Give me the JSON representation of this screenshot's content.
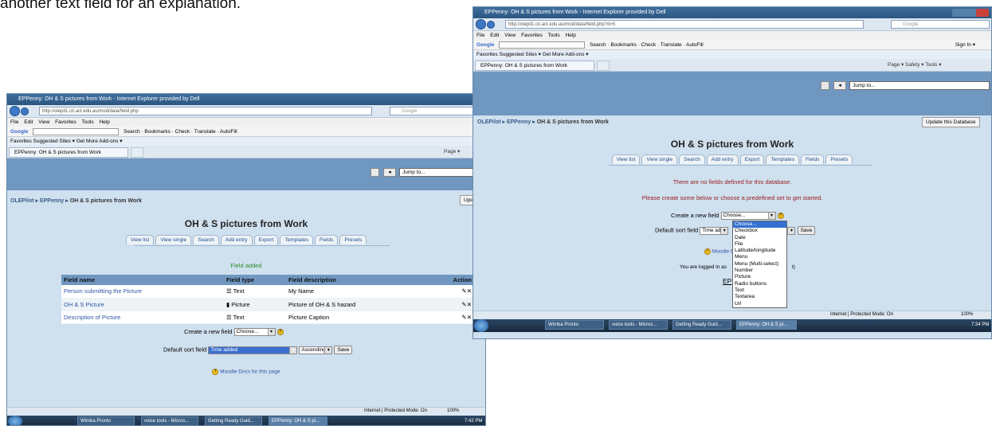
{
  "caption": "another text field for an explanation.",
  "win1": {
    "title": "EPPenny: OH & S pictures from Work - Internet Explorer provided by Dell",
    "url_host": "olepil1.cit.act.edu.au",
    "url_path": "http://olepil1.cit.act.edu.au/mod/data/field.php",
    "search_engine": "Google",
    "menu": "File Edit View Favorites Tools Help",
    "gbar": "Search · Bookmarks · Check · Translate · AutoFill",
    "favorites": "Favorites   Suggested Sites ▾   Get More Add-ons ▾",
    "tab": "EPPenny: OH & S pictures from Work",
    "cmd": "Page ▾",
    "jump": "Jump to...",
    "breadcrumb": {
      "a": "OLEPilot",
      "b": "EPPenny",
      "c": "OH & S pictures from Work"
    },
    "update_btn": "Upd",
    "page_title": "OH & S pictures from Work",
    "tabs": [
      "View list",
      "View single",
      "Search",
      "Add entry",
      "Export",
      "Templates",
      "Fields",
      "Presets"
    ],
    "field_added": "Field added",
    "table": {
      "headers": [
        "Field name",
        "Field type",
        "Field description",
        "Action"
      ],
      "rows": [
        {
          "name": "Person submitting the Picture",
          "type": "Text",
          "desc": "My Name",
          "action": "✎✕"
        },
        {
          "name": "OH & S Picture",
          "type": "Picture",
          "desc": "Picture of OH & S hazard",
          "action": "✎✕"
        },
        {
          "name": "Description of Picture",
          "type": "Text",
          "desc": "Picture Caption",
          "action": "✎✕"
        }
      ]
    },
    "create_label": "Create a new field",
    "create_value": "Choose...",
    "sort_label": "Default sort field",
    "sort_value": "Time added",
    "sort_order": "Ascending",
    "save": "Save",
    "docs": "Moodle Docs for this page",
    "status": "Internet | Protected Mode: On",
    "zoom": "100%",
    "taskbar": [
      "Wimba Pronto",
      "voice tools - Micros...",
      "Getting Ready Guid...",
      "EPPenny: OH & S pi..."
    ],
    "time": "7:42 PM"
  },
  "win2": {
    "title": "EPPenny: OH & S pictures from Work - Internet Explorer provided by Dell",
    "url_host": "olepil1.cit.act.edu.au",
    "url_path": "http://olepil1.cit.act.edu.au/mod/data/field.php?d=5",
    "search_engine": "Google",
    "menu": "File Edit View Favorites Tools Help",
    "gbar": "Search · Bookmarks · Check · Translate · AutoFill",
    "signin": "Sign In ▾",
    "favorites": "Favorites   Suggested Sites ▾   Get More Add-ons ▾",
    "tab": "EPPenny: OH & S pictures from Work",
    "cmd": "Page ▾  Safety ▾  Tools ▾",
    "jump": "Jump to...",
    "breadcrumb": {
      "a": "OLEPilot",
      "b": "EPPenny",
      "c": "OH & S pictures from Work"
    },
    "update_btn": "Update this Database",
    "page_title": "OH & S pictures from Work",
    "tabs": [
      "View list",
      "View single",
      "Search",
      "Add entry",
      "Export",
      "Templates",
      "Fields",
      "Presets"
    ],
    "no_fields": "There are no fields defined for this database.",
    "create_msg": "Please create some below or choose a predefined set to get started.",
    "create_label": "Create a new field",
    "create_value": "Choose...",
    "sort_label": "Default sort field",
    "sort_value": "Time adde",
    "save": "Save",
    "docs": "Moodle D",
    "logged_in": "You are logged in as",
    "logged_tail": "t)",
    "epp": "EP",
    "options": [
      "Choose...",
      "Checkbox",
      "Date",
      "File",
      "Latitude/longitude",
      "Menu",
      "Menu (Multi-select)",
      "Number",
      "Picture",
      "Radio buttons",
      "Text",
      "Textarea",
      "Url"
    ],
    "status": "Internet | Protected Mode: On",
    "zoom": "100%",
    "taskbar": [
      "Wimba Pronto",
      "voice tools - Micros...",
      "Getting Ready Guid...",
      "EPPenny: OH & S pi..."
    ],
    "time": "7:34 PM"
  }
}
